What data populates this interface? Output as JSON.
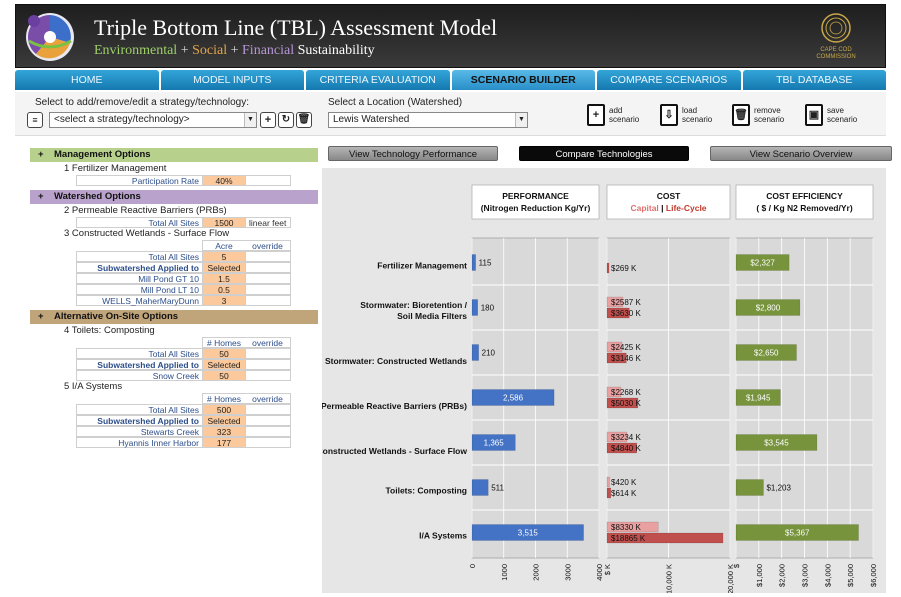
{
  "header": {
    "title": "Triple Bottom Line (TBL) Assessment Model",
    "subtitle": [
      {
        "text": "Environmental",
        "color": "#9dd06a"
      },
      {
        "text": " + ",
        "color": "#dddddd"
      },
      {
        "text": "Social",
        "color": "#e3a44a"
      },
      {
        "text": " + ",
        "color": "#dddddd"
      },
      {
        "text": "Financial",
        "color": "#b597d6"
      },
      {
        "text": "  Sustainability",
        "color": "#ffffff"
      }
    ],
    "brand_line1": "CAPE COD",
    "brand_line2": "COMMISSION"
  },
  "nav": {
    "tabs": [
      "HOME",
      "MODEL INPUTS",
      "CRITERIA  EVALUATION",
      "SCENARIO BUILDER",
      "COMPARE SCENARIOS",
      "TBL DATABASE"
    ],
    "active": 3
  },
  "toolbar": {
    "strategy_label": "Select to add/remove/edit  a strategy/technology:",
    "strategy_value": "<select a strategy/technology>",
    "location_label": "Select a Location (Watershed)",
    "location_value": "Lewis Watershed",
    "scenario_buttons": [
      {
        "line1": "add",
        "line2": "scenario",
        "icon": "add-document-icon"
      },
      {
        "line1": "load",
        "line2": "scenario",
        "icon": "download-document-icon"
      },
      {
        "line1": "remove",
        "line2": "scenario",
        "icon": "trash-document-icon"
      },
      {
        "line1": "save",
        "line2": "scenario",
        "icon": "save-document-icon"
      }
    ]
  },
  "left": {
    "mgmt": {
      "title": "Management Options",
      "item1": "1 Fertilizer Management",
      "participation_label": "Participation Rate",
      "participation_value": "40%"
    },
    "water": {
      "title": "Watershed Options",
      "item2": "2 Permeable Reactive Barriers (PRBs)",
      "prb_label": "Total All Sites",
      "prb_value": "1500",
      "prb_unit": "linear feet",
      "item3": "3 Constructed Wetlands - Surface Flow",
      "cw_head_value": "Acre",
      "cw_head_override": "override",
      "cw_total_label": "Total All Sites",
      "cw_total_value": "5",
      "cw_sub_label": "Subwatershed Applied to",
      "cw_sub_value": "Selected",
      "cw_rows": [
        {
          "label": "Mill Pond GT 10",
          "value": "1.5"
        },
        {
          "label": "Mill Pond LT 10",
          "value": "0.5"
        },
        {
          "label": "WELLS_MaherMaryDunn",
          "value": "3"
        }
      ]
    },
    "alt": {
      "title": "Alternative On-Site Options",
      "item4": "4 Toilets: Composting",
      "tc_head_value": "# Homes",
      "tc_head_override": "override",
      "tc_total_label": "Total All Sites",
      "tc_total_value": "50",
      "tc_sub_label": "Subwatershed Applied to",
      "tc_sub_value": "Selected",
      "tc_rows": [
        {
          "label": "Snow Creek",
          "value": "50"
        }
      ],
      "item5": "5 I/A Systems",
      "ia_head_value": "# Homes",
      "ia_head_override": "override",
      "ia_total_label": "Total All Sites",
      "ia_total_value": "500",
      "ia_sub_label": "Subwatershed Applied to",
      "ia_sub_value": "Selected",
      "ia_rows": [
        {
          "label": "Stewarts Creek",
          "value": "323"
        },
        {
          "label": "Hyannis Inner Harbor",
          "value": "177"
        }
      ]
    }
  },
  "view_buttons": {
    "performance": "View Technology Performance",
    "compare": "Compare Technologies",
    "overview": "View Scenario Overview"
  },
  "chart_data": {
    "type": "bar",
    "orientation": "horizontal",
    "categories": [
      "Fertilizer Management",
      "Stormwater: Bioretention / Soil Media Filters",
      "Stormwater: Constructed Wetlands",
      "Permeable Reactive Barriers (PRBs)",
      "Constructed Wetlands - Surface Flow",
      "Toilets: Composting",
      "I/A Systems"
    ],
    "panels": [
      {
        "title": "PERFORMANCE",
        "subtitle": "(Nitrogen Reduction Kg/Yr)",
        "series": [
          {
            "values": [
              115,
              180,
              210,
              2586,
              1365,
              511,
              3515
            ],
            "labels": [
              "115",
              "180",
              "210",
              "2,586",
              "1,365",
              "511",
              "3,515"
            ],
            "color": "#4472c4"
          }
        ],
        "xlim": [
          0,
          4000
        ],
        "ticks": [
          "0",
          "1000",
          "2000",
          "3000",
          "4000"
        ]
      },
      {
        "title": "COST",
        "subtitle_parts": [
          {
            "text": "Capital",
            "color": "#e07070"
          },
          {
            "text": " | ",
            "color": "#000000"
          },
          {
            "text": "Life-Cycle",
            "color": "#c0392b"
          }
        ],
        "series": [
          {
            "name": "Capital",
            "values": [
              0,
              2587,
              2425,
              2268,
              3234,
              420,
              8330
            ],
            "labels": [
              "",
              "$2587 K",
              "$2425 K",
              "$2268 K",
              "$3234 K",
              "$420 K",
              "$8330 K"
            ],
            "color": "#e8a0a0"
          },
          {
            "name": "Life-Cycle",
            "values": [
              269,
              3630,
              3146,
              5030,
              4840,
              614,
              18865
            ],
            "labels": [
              "$269 K",
              "$3630 K",
              "$3146 K",
              "$5030 K",
              "$4840 K",
              "$614 K",
              "$18865 K"
            ],
            "color": "#c0504d"
          }
        ],
        "xlim": [
          0,
          20000
        ],
        "ticks": [
          "$ K",
          "$10,000 K",
          "$20,000 K"
        ]
      },
      {
        "title": "COST EFFICIENCY",
        "subtitle": "( $ / Kg N2 Removed/Yr)",
        "series": [
          {
            "values": [
              2327,
              2800,
              2650,
              1945,
              3545,
              1203,
              5367
            ],
            "labels": [
              "$2,327",
              "$2,800",
              "$2,650",
              "$1,945",
              "$3,545",
              "$1,203",
              "$5,367"
            ],
            "color": "#77933c"
          }
        ],
        "xlim": [
          0,
          6000
        ],
        "ticks": [
          "$",
          "$1,000",
          "$2,000",
          "$3,000",
          "$4,000",
          "$5,000",
          "$6,000"
        ]
      }
    ]
  }
}
